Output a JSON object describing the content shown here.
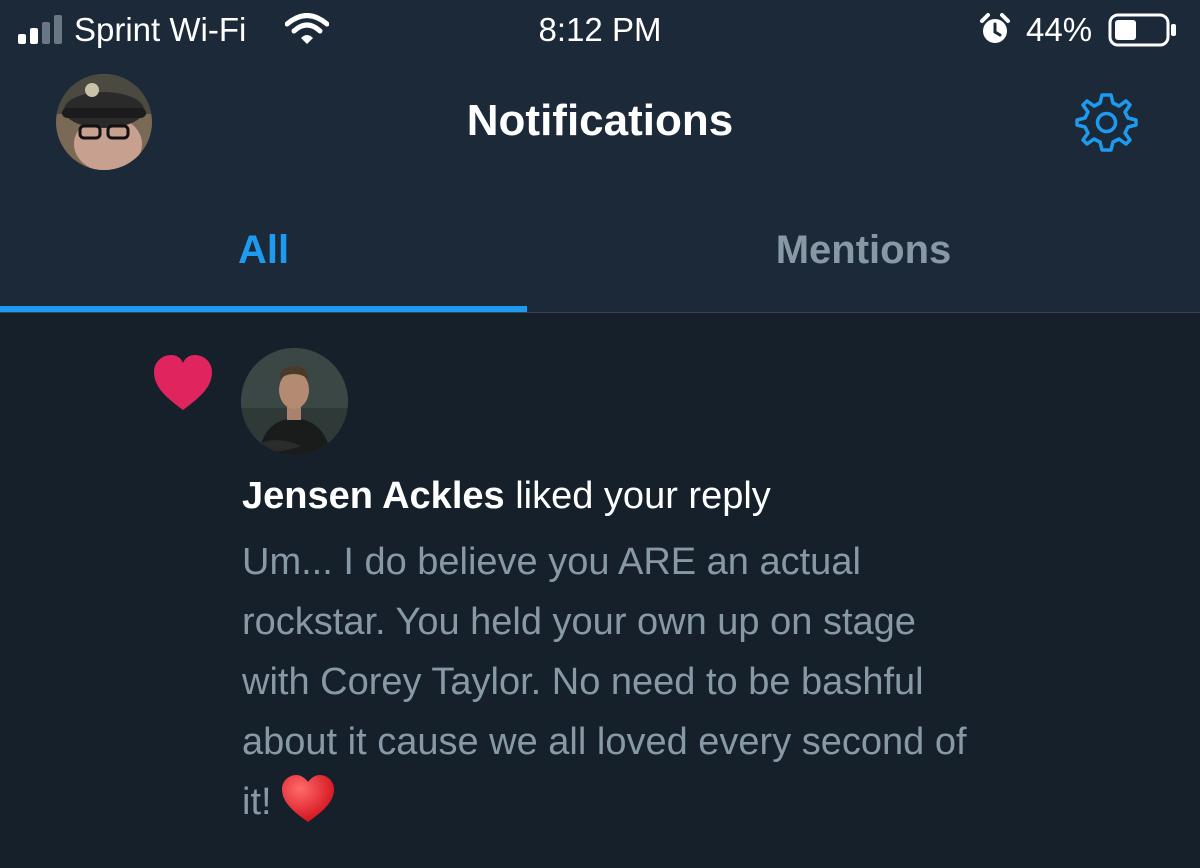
{
  "status_bar": {
    "carrier": "Sprint Wi-Fi",
    "time": "8:12 PM",
    "battery_percent": "44%",
    "battery_level": 0.44,
    "signal_bars": 2
  },
  "header": {
    "title": "Notifications"
  },
  "tabs": [
    {
      "label": "All",
      "active": true
    },
    {
      "label": "Mentions",
      "active": false
    }
  ],
  "notification": {
    "type_icon": "heart-icon",
    "user_name": "Jensen Ackles",
    "action": "liked your reply",
    "tweet_text": "Um... I do believe you ARE an actual\nrockstar. You held your own up on stage\nwith Corey Taylor. No need to be bashful\nabout it cause we all loved every second of\nit!",
    "emoji": "red-heart"
  },
  "colors": {
    "background": "#15202b",
    "header_background": "#1c2938",
    "accent": "#1d9bf0",
    "like": "#e0245e",
    "muted_text": "#8899a6"
  }
}
